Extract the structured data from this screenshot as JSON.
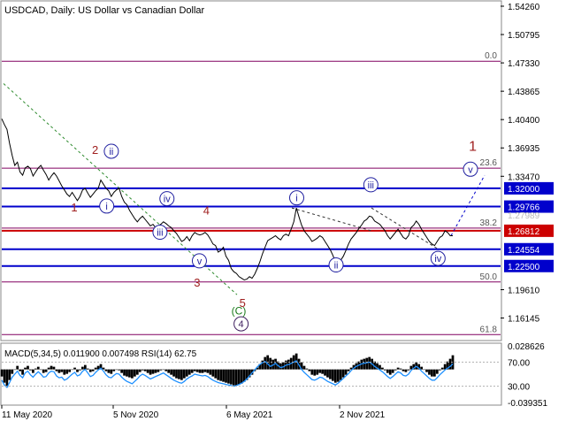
{
  "header": {
    "symbol_title": "USDCAD, Daily:  US Dollar vs Canadian Dollar",
    "indicator_title": "MACD(5,34,5) 0.011900 0.007498 RSI(14) 62.75"
  },
  "colors": {
    "background": "#ffffff",
    "price_line": "#000000",
    "blue_level": "#0000cc",
    "red_level": "#cc0000",
    "fib_line": "#800060",
    "wave_label_red": "#a02020",
    "wave_label_blue": "#2020a0",
    "wave_label_green": "#1a7a1a",
    "macd_hist": "#000000",
    "rsi_line": "#1e90ff",
    "grid": "#b0b0b0"
  },
  "chart_data": {
    "type": "line",
    "title": "USDCAD, Daily:  US Dollar vs Canadian Dollar",
    "ylim": [
      1.135,
      1.548
    ],
    "price_axis_ticks": [
      "1.54260",
      "1.50795",
      "1.47330",
      "1.43865",
      "1.40400",
      "1.36935",
      "1.33470",
      "1.29766",
      "1.26812",
      "1.24554",
      "1.22500",
      "1.19610",
      "1.16145"
    ],
    "x_tick_labels": [
      "11 May 2020",
      "5 Nov 2020",
      "6 May 2021",
      "2 Nov 2021"
    ],
    "price_series": {
      "name": "USDCAD",
      "values": [
        1.405,
        1.398,
        1.392,
        1.375,
        1.36,
        1.348,
        1.352,
        1.34,
        1.336,
        1.345,
        1.347,
        1.344,
        1.335,
        1.34,
        1.345,
        1.348,
        1.342,
        1.337,
        1.33,
        1.335,
        1.339,
        1.335,
        1.329,
        1.323,
        1.318,
        1.313,
        1.31,
        1.315,
        1.31,
        1.305,
        1.31,
        1.318,
        1.32,
        1.314,
        1.309,
        1.313,
        1.317,
        1.32,
        1.33,
        1.325,
        1.32,
        1.317,
        1.31,
        1.315,
        1.318,
        1.32,
        1.31,
        1.303,
        1.3,
        1.293,
        1.288,
        1.283,
        1.279,
        1.283,
        1.286,
        1.282,
        1.278,
        1.274,
        1.276,
        1.272,
        1.274,
        1.276,
        1.279,
        1.277,
        1.274,
        1.272,
        1.268,
        1.265,
        1.26,
        1.255,
        1.257,
        1.261,
        1.256,
        1.262,
        1.266,
        1.264,
        1.263,
        1.264,
        1.266,
        1.263,
        1.258,
        1.252,
        1.25,
        1.242,
        1.244,
        1.248,
        1.237,
        1.232,
        1.222,
        1.218,
        1.216,
        1.212,
        1.21,
        1.208,
        1.209,
        1.212,
        1.21,
        1.215,
        1.222,
        1.23,
        1.24,
        1.248,
        1.256,
        1.258,
        1.26,
        1.262,
        1.259,
        1.257,
        1.262,
        1.264,
        1.262,
        1.27,
        1.279,
        1.296,
        1.285,
        1.275,
        1.268,
        1.264,
        1.26,
        1.255,
        1.257,
        1.259,
        1.262,
        1.26,
        1.255,
        1.25,
        1.245,
        1.238,
        1.23,
        1.228,
        1.232,
        1.237,
        1.244,
        1.252,
        1.258,
        1.262,
        1.266,
        1.271,
        1.275,
        1.28,
        1.282,
        1.286,
        1.285,
        1.28,
        1.278,
        1.276,
        1.272,
        1.268,
        1.262,
        1.258,
        1.262,
        1.266,
        1.27,
        1.265,
        1.26,
        1.258,
        1.262,
        1.272,
        1.275,
        1.28,
        1.276,
        1.27,
        1.265,
        1.26,
        1.255,
        1.252,
        1.25,
        1.255,
        1.26,
        1.262,
        1.268,
        1.266,
        1.262,
        1.262
      ]
    },
    "horizontal_levels": [
      {
        "kind": "fib",
        "label": "0.0",
        "value": 1.4753
      },
      {
        "kind": "fib",
        "label": "23.6",
        "value": 1.3446
      },
      {
        "kind": "blue",
        "label": "1.32000",
        "value": 1.32
      },
      {
        "kind": "blue",
        "label": "1.29766",
        "value": 1.29766
      },
      {
        "kind": "fib",
        "label": "38.2",
        "value": 1.2714
      },
      {
        "kind": "red",
        "label": "1.26812",
        "value": 1.26812
      },
      {
        "kind": "blue",
        "label": "1.24554",
        "value": 1.24554
      },
      {
        "kind": "blue",
        "label": "1.22500",
        "value": 1.225
      },
      {
        "kind": "fib",
        "label": "50.0",
        "value": 1.2055
      },
      {
        "kind": "fib",
        "label": "61.8",
        "value": 1.1412
      }
    ],
    "overlapped_price_label": "1.27989",
    "wave_labels": [
      {
        "text": "1",
        "style": "red",
        "x": 0.145,
        "y": 1.292
      },
      {
        "text": "2",
        "style": "red",
        "x": 0.19,
        "y": 1.362
      },
      {
        "text": "ii",
        "style": "blue-circle",
        "x": 0.225,
        "y": 1.361
      },
      {
        "text": "i",
        "style": "blue-circle",
        "x": 0.215,
        "y": 1.294
      },
      {
        "text": "iv",
        "style": "blue-circle",
        "x": 0.345,
        "y": 1.303
      },
      {
        "text": "4",
        "style": "red",
        "x": 0.43,
        "y": 1.288
      },
      {
        "text": "iii",
        "style": "blue-circle",
        "x": 0.33,
        "y": 1.262
      },
      {
        "text": "v",
        "style": "blue-circle",
        "x": 0.415,
        "y": 1.227
      },
      {
        "text": "3",
        "style": "red",
        "x": 0.41,
        "y": 1.2
      },
      {
        "text": "5",
        "style": "red",
        "x": 0.508,
        "y": 1.175
      },
      {
        "text": "C",
        "style": "green-paren",
        "x": 0.5,
        "y": 1.166
      },
      {
        "text": "4",
        "style": "purple-circle",
        "x": 0.505,
        "y": 1.15
      },
      {
        "text": "i",
        "style": "blue-circle",
        "x": 0.625,
        "y": 1.304
      },
      {
        "text": "iii",
        "style": "blue-circle",
        "x": 0.785,
        "y": 1.32
      },
      {
        "text": "ii",
        "style": "blue-circle",
        "x": 0.71,
        "y": 1.222
      },
      {
        "text": "iv",
        "style": "blue-circle",
        "x": 0.93,
        "y": 1.23
      },
      {
        "text": "v",
        "style": "blue-circle",
        "x": 1.0,
        "y": 1.339
      },
      {
        "text": "1",
        "style": "red",
        "x": 1.005,
        "y": 1.366
      }
    ],
    "indicator": {
      "type": "bar",
      "right_axis_ticks": [
        "0.028626",
        "70.00",
        "30.00",
        "-0.039351"
      ],
      "ylim": [
        -0.039351,
        0.028626
      ],
      "macd_hist": [
        -0.008,
        -0.015,
        -0.02,
        -0.012,
        -0.005,
        0.0,
        0.004,
        -0.002,
        -0.006,
        0.002,
        0.004,
        -0.001,
        -0.004,
        0.001,
        0.003,
        0.0,
        -0.004,
        -0.003,
        0.002,
        0.004,
        0.003,
        -0.002,
        -0.004,
        -0.003,
        -0.006,
        -0.005,
        -0.003,
        0.0,
        0.002,
        -0.003,
        -0.001,
        0.003,
        0.005,
        0.001,
        -0.003,
        -0.002,
        0.002,
        0.004,
        0.006,
        0.002,
        -0.002,
        -0.004,
        -0.005,
        -0.002,
        0.0,
        -0.001,
        -0.004,
        -0.007,
        -0.008,
        -0.009,
        -0.01,
        -0.008,
        -0.006,
        -0.003,
        -0.001,
        -0.002,
        -0.004,
        -0.006,
        -0.005,
        -0.004,
        -0.003,
        -0.001,
        0.0,
        -0.002,
        -0.004,
        -0.006,
        -0.008,
        -0.01,
        -0.011,
        -0.012,
        -0.01,
        -0.008,
        -0.006,
        -0.004,
        -0.002,
        -0.003,
        -0.004,
        -0.004,
        -0.003,
        -0.004,
        -0.006,
        -0.008,
        -0.01,
        -0.012,
        -0.013,
        -0.014,
        -0.015,
        -0.016,
        -0.017,
        -0.018,
        -0.018,
        -0.017,
        -0.016,
        -0.014,
        -0.012,
        -0.009,
        -0.006,
        -0.002,
        0.002,
        0.006,
        0.01,
        0.014,
        0.016,
        0.013,
        0.011,
        0.012,
        0.009,
        0.007,
        0.008,
        0.01,
        0.011,
        0.013,
        0.016,
        0.018,
        0.012,
        0.008,
        0.004,
        0.001,
        -0.002,
        -0.006,
        -0.007,
        -0.006,
        -0.004,
        -0.005,
        -0.007,
        -0.009,
        -0.011,
        -0.013,
        -0.015,
        -0.014,
        -0.012,
        -0.009,
        -0.006,
        -0.002,
        0.002,
        0.005,
        0.007,
        0.009,
        0.011,
        0.012,
        0.013,
        0.014,
        0.012,
        0.009,
        0.007,
        0.005,
        0.002,
        -0.001,
        -0.004,
        -0.006,
        -0.004,
        -0.001,
        0.002,
        0.001,
        -0.002,
        -0.003,
        -0.001,
        0.004,
        0.006,
        0.008,
        0.006,
        0.003,
        0.0,
        -0.003,
        -0.006,
        -0.008,
        -0.008,
        -0.005,
        -0.001,
        0.002,
        0.006,
        0.009,
        0.012,
        0.016
      ],
      "rsi_values": [
        40,
        32,
        28,
        36,
        45,
        50,
        55,
        48,
        44,
        52,
        55,
        49,
        45,
        50,
        54,
        50,
        45,
        46,
        52,
        55,
        54,
        47,
        44,
        45,
        40,
        42,
        46,
        50,
        53,
        47,
        49,
        55,
        58,
        52,
        46,
        48,
        53,
        57,
        60,
        55,
        49,
        45,
        44,
        48,
        51,
        50,
        45,
        41,
        38,
        36,
        34,
        38,
        42,
        47,
        50,
        48,
        45,
        42,
        44,
        46,
        48,
        50,
        52,
        49,
        46,
        43,
        40,
        38,
        36,
        35,
        38,
        42,
        45,
        47,
        50,
        49,
        48,
        47,
        48,
        46,
        43,
        40,
        38,
        36,
        35,
        34,
        33,
        32,
        31,
        30,
        31,
        33,
        35,
        38,
        42,
        47,
        52,
        57,
        62,
        66,
        69,
        71,
        67,
        63,
        65,
        68,
        64,
        61,
        62,
        65,
        66,
        68,
        70,
        72,
        65,
        58,
        53,
        49,
        45,
        41,
        40,
        42,
        45,
        44,
        41,
        38,
        36,
        34,
        32,
        35,
        39,
        43,
        47,
        51,
        56,
        60,
        63,
        65,
        67,
        68,
        69,
        70,
        67,
        63,
        60,
        57,
        54,
        50,
        46,
        43,
        46,
        50,
        54,
        52,
        48,
        47,
        50,
        56,
        60,
        63,
        60,
        55,
        51,
        47,
        43,
        40,
        40,
        44,
        49,
        53,
        57,
        60,
        63,
        67
      ]
    }
  }
}
